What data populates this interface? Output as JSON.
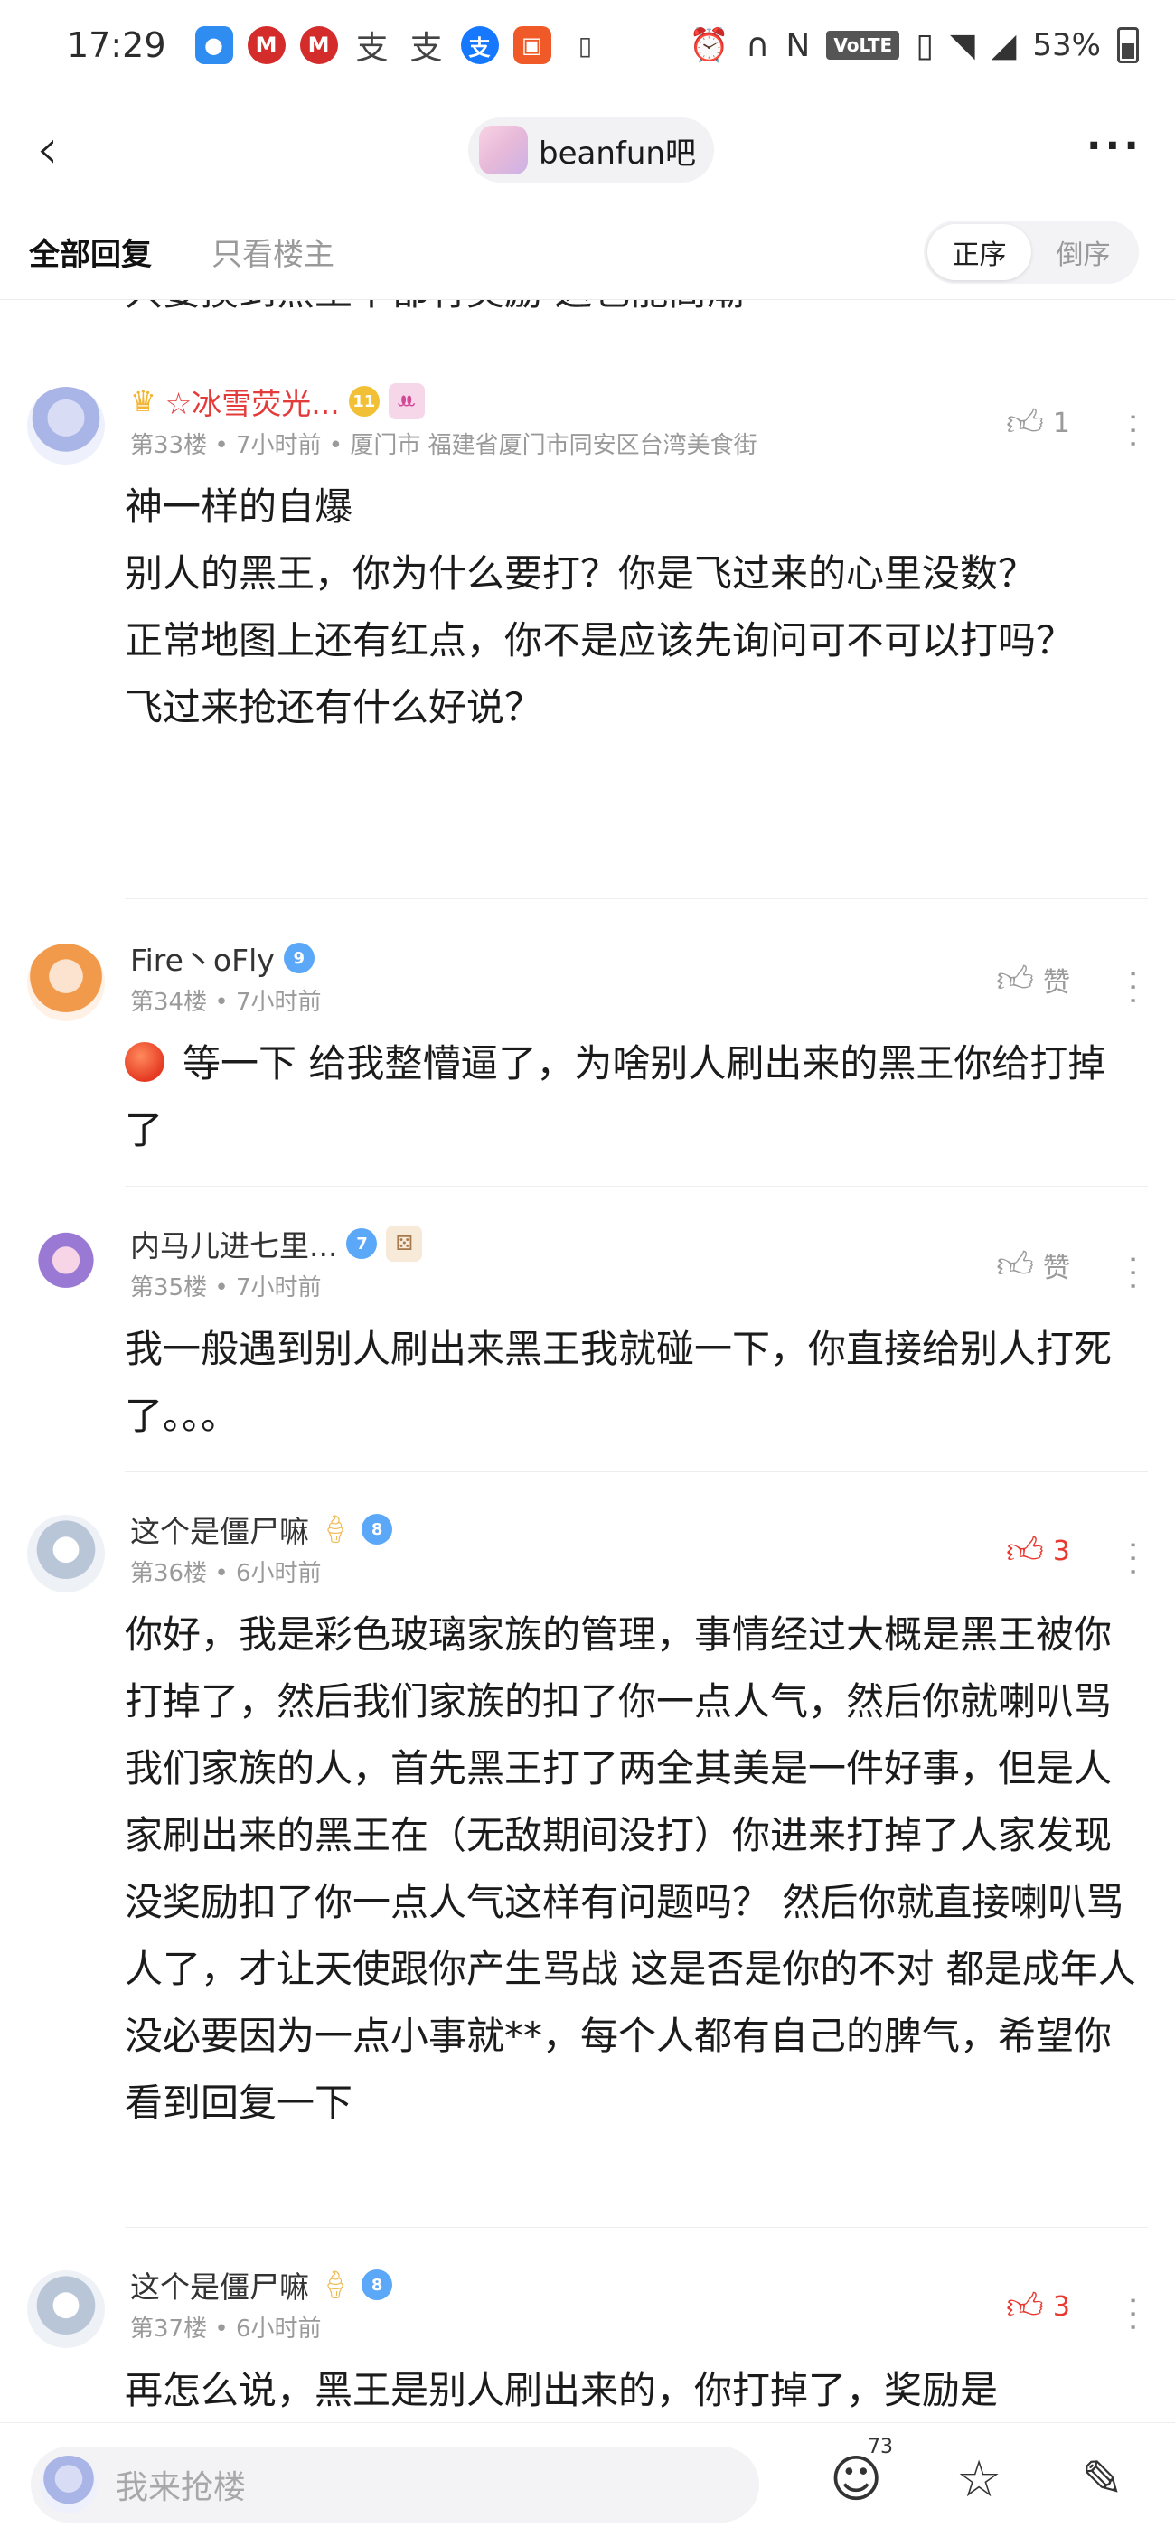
{
  "status_bar": {
    "time": "17:29",
    "network": "VoLTE",
    "battery": "53%"
  },
  "nav": {
    "bar_name": "beanfun吧"
  },
  "filter": {
    "all_replies": "全部回复",
    "host_only": "只看楼主",
    "sort_asc": "正序",
    "sort_desc": "倒序"
  },
  "cut_off_text": "只要摸到黑王不都有奖励 这也能高潮",
  "posts": [
    {
      "username": "☆冰雪荧光...",
      "level": "11",
      "deco": "ꔚ",
      "meta": "第33楼 • 7小时前 • 厦门市 福建省厦门市同安区台湾美食街",
      "likes": "1",
      "content": "神一样的自爆\n别人的黑王，你为什么要打？你是飞过来的心里没数？\n正常地图上还有红点，你不是应该先询问可不可以打吗？\n飞过来抢还有什么好说？"
    },
    {
      "username": "Fire丶oFly",
      "level": "9",
      "meta": "第34楼 • 7小时前",
      "likes": "赞",
      "content": "等一下 给我整懵逼了，为啥别人刷出来的黑王你给打掉了"
    },
    {
      "username": "内马儿进七里...",
      "level": "7",
      "meta": "第35楼 • 7小时前",
      "likes": "赞",
      "content": "我一般遇到别人刷出来黑王我就碰一下，你直接给别人打死了。。。"
    },
    {
      "username": "这个是僵尸嘛",
      "level": "8",
      "meta": "第36楼 • 6小时前",
      "likes": "3",
      "content": "你好，我是彩色玻璃家族的管理，事情经过大概是黑王被你打掉了，然后我们家族的扣了你一点人气，然后你就喇叭骂我们家族的人，首先黑王打了两全其美是一件好事，但是人家刷出来的黑王在（无敌期间没打）你进来打掉了人家发现没奖励扣了你一点人气这样有问题吗？ 然后你就直接喇叭骂人了，才让天使跟你产生骂战 这是否是你的不对 都是成年人 没必要因为一点小事就**，每个人都有自己的脾气，希望你看到回复一下"
    },
    {
      "username": "这个是僵尸嘛",
      "level": "8",
      "meta": "第37楼 • 6小时前",
      "likes": "3",
      "content": "再怎么说，黑王是别人刷出来的，你打掉了，奖励是"
    }
  ],
  "bottom": {
    "reply_placeholder": "我来抢楼",
    "emoji_count": "73"
  }
}
